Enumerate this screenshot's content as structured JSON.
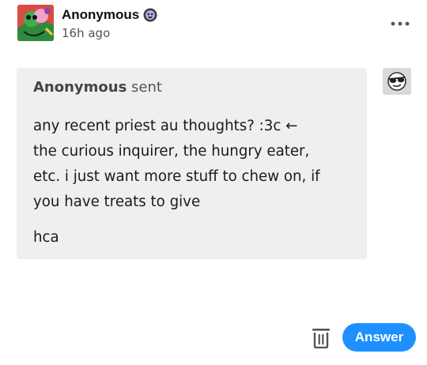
{
  "header": {
    "blog_name": "Anonymous",
    "timestamp": "16h ago",
    "badge_icon": "emoji-badge-icon",
    "more_icon": "more-dots-icon"
  },
  "ask": {
    "asker": "Anonymous",
    "sent_label": "sent",
    "body": "any recent priest au thoughts? :3c ←\nthe curious inquirer, the hungry eater,\netc. i just want more stuff to chew on, if\nyou have treats to give",
    "signoff": "hca"
  },
  "asker_avatar": {
    "icon": "sunglasses-face-icon"
  },
  "actions": {
    "delete_icon": "trash-icon",
    "answer_label": "Answer"
  },
  "colors": {
    "accent": "#1e90ff",
    "bubble_bg": "#efefef",
    "avatar_bg": "#d94b43"
  }
}
